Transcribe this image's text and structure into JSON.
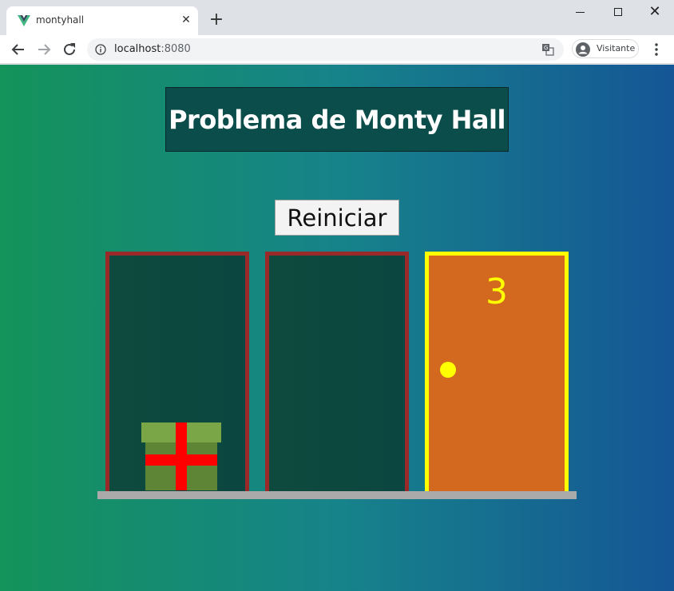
{
  "browser": {
    "tab_title": "montyhall",
    "tab_close": "✕",
    "new_tab": "+",
    "win_close": "✕",
    "url_host": "localhost",
    "url_port": ":8080",
    "profile_name": "Visitante"
  },
  "page": {
    "title": "Problema de Monty Hall",
    "reset_label": "Reiniciar",
    "doors": [
      {
        "state": "open",
        "has_prize": true
      },
      {
        "state": "open",
        "has_prize": false
      },
      {
        "state": "closed",
        "number": "3",
        "selected": true
      }
    ]
  },
  "colors": {
    "gradient_left": "#14935a",
    "gradient_right": "#155696",
    "title_bg": "#0b4d4a",
    "open_door_frame": "#9a2a2a",
    "closed_door": "#d2691e",
    "selected_frame": "#ffff00",
    "gift_lid": "#7aa648",
    "gift_box": "#5e8535",
    "ribbon": "#ff0000"
  }
}
